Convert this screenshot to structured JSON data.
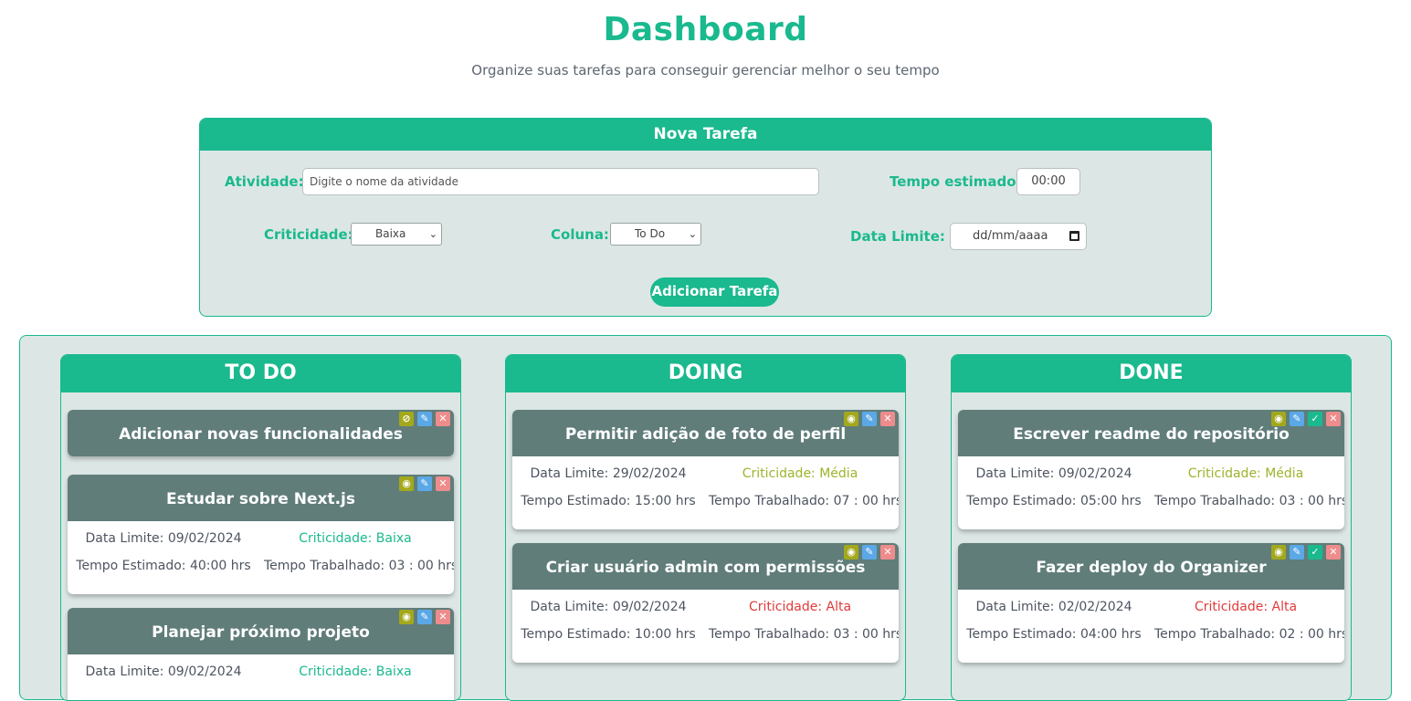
{
  "header": {
    "title": "Dashboard",
    "subtitle": "Organize suas tarefas para conseguir gerenciar melhor o seu tempo"
  },
  "form": {
    "title": "Nova Tarefa",
    "activity_label": "Atividade:",
    "activity_placeholder": "Digite o nome da atividade",
    "time_label": "Tempo estimado:",
    "time_value": "00:00",
    "criticality_label": "Criticidade:",
    "criticality_value": "Baixa",
    "column_label": "Coluna:",
    "column_value": "To Do",
    "deadline_label": "Data Limite:",
    "deadline_placeholder": "dd/mm/aaaa",
    "submit_label": "Adicionar Tarefa"
  },
  "columns": [
    {
      "title": "TO DO",
      "cards": [
        {
          "title": "Adicionar novas funcionalidades",
          "collapsed": true,
          "icons": [
            "eye-off",
            "edit",
            "close"
          ]
        },
        {
          "title": "Estudar sobre Next.js",
          "deadline": "Data Limite: 09/02/2024",
          "criticality": "Criticidade: Baixa",
          "estimated": "Tempo Estimado: 40:00 hrs",
          "worked": "Tempo Trabalhado: 03 : 00 hrs",
          "level": "baixa"
        },
        {
          "title": "Planejar próximo projeto",
          "deadline": "Data Limite: 09/02/2024",
          "criticality": "Criticidade: Baixa",
          "level": "baixa"
        }
      ]
    },
    {
      "title": "DOING",
      "cards": [
        {
          "title": "Permitir adição de foto de perfil",
          "deadline": "Data Limite: 29/02/2024",
          "criticality": "Criticidade: Média",
          "estimated": "Tempo Estimado: 15:00 hrs",
          "worked": "Tempo Trabalhado: 07 : 00 hrs",
          "level": "media"
        },
        {
          "title": "Criar usuário admin com permissões",
          "deadline": "Data Limite: 09/02/2024",
          "criticality": "Criticidade: Alta",
          "estimated": "Tempo Estimado: 10:00 hrs",
          "worked": "Tempo Trabalhado: 03 : 00 hrs",
          "level": "alta"
        }
      ]
    },
    {
      "title": "DONE",
      "cards": [
        {
          "title": "Escrever readme do repositório",
          "deadline": "Data Limite: 09/02/2024",
          "criticality": "Criticidade: Média",
          "estimated": "Tempo Estimado: 05:00 hrs",
          "worked": "Tempo Trabalhado: 03 : 00 hrs",
          "level": "media"
        },
        {
          "title": "Fazer deploy do Organizer",
          "deadline": "Data Limite: 02/02/2024",
          "criticality": "Criticidade: Alta",
          "estimated": "Tempo Estimado: 04:00 hrs",
          "worked": "Tempo Trabalhado: 02 : 00 hrs",
          "level": "alta"
        }
      ]
    }
  ],
  "colors": {
    "accent": "#1ab98e",
    "card_header": "#607d7a",
    "panel_bg": "#dce7e5",
    "crit_baixa": "#1ab98e",
    "crit_media": "#9bb52c",
    "crit_alta": "#e03b3b"
  }
}
